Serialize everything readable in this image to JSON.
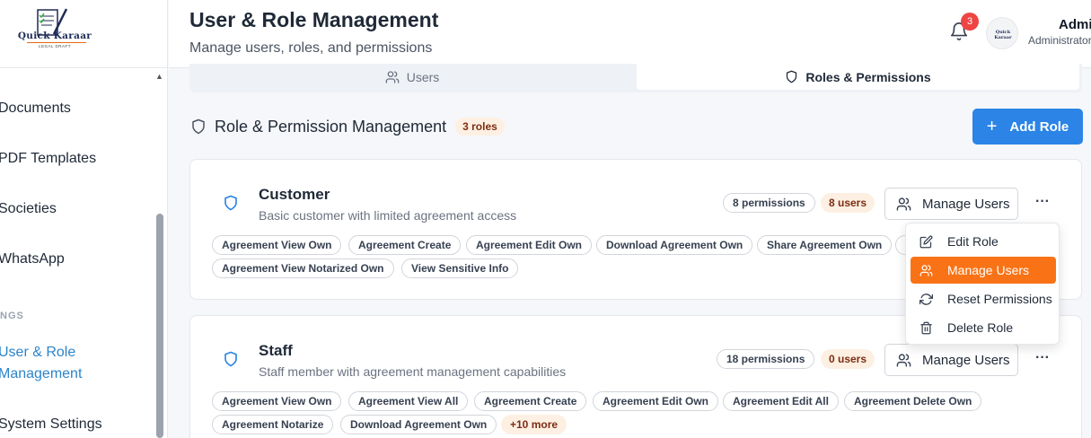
{
  "brand": {
    "name": "Quick Karaar",
    "tagline": "LEGAL DRAFT",
    "avatar_text": "Quick Karaar"
  },
  "sidebar": {
    "items": [
      {
        "label": "Documents"
      },
      {
        "label": "PDF Templates"
      },
      {
        "label": "Societies"
      },
      {
        "label": "WhatsApp"
      }
    ],
    "section_label": "NGS",
    "active_item": {
      "line1": "User & Role",
      "line2": "Management"
    },
    "after_items": [
      {
        "label": "System Settings"
      }
    ]
  },
  "header": {
    "title": "User & Role Management",
    "subtitle": "Manage users, roles, and permissions",
    "notification_count": "3",
    "user_name": "Admin",
    "user_role": "Administrator"
  },
  "tabs": [
    {
      "label": "Users",
      "icon": "users-icon",
      "active": false
    },
    {
      "label": "Roles & Permissions",
      "icon": "shield-icon",
      "active": true
    }
  ],
  "section": {
    "title": "Role & Permission Management",
    "count_badge": "3 roles",
    "add_button": "Add Role"
  },
  "roles": [
    {
      "name": "Customer",
      "description": "Basic customer with limited agreement access",
      "permissions_count": "8 permissions",
      "users_count": "8 users",
      "manage_label": "Manage Users",
      "permissions": [
        "Agreement View Own",
        "Agreement Create",
        "Agreement Edit Own",
        "Download Agreement Own",
        "Share Agreement Own",
        "",
        "Agreement View Notarized Own",
        "View Sensitive Info"
      ]
    },
    {
      "name": "Staff",
      "description": "Staff member with agreement management capabilities",
      "permissions_count": "18 permissions",
      "users_count": "0 users",
      "manage_label": "Manage Users",
      "permissions": [
        "Agreement View Own",
        "Agreement View All",
        "Agreement Create",
        "Agreement Edit Own",
        "Agreement Edit All",
        "Agreement Delete Own",
        "Agreement Notarize",
        "Download Agreement Own"
      ],
      "more_label": "+10 more"
    }
  ],
  "dropdown": {
    "items": [
      {
        "label": "Edit Role",
        "icon": "edit-icon"
      },
      {
        "label": "Manage Users",
        "icon": "users-icon",
        "highlighted": true
      },
      {
        "label": "Reset Permissions",
        "icon": "refresh-icon"
      },
      {
        "label": "Delete Role",
        "icon": "trash-icon"
      }
    ]
  },
  "colors": {
    "primary": "#2b84e6",
    "accent": "#f97316",
    "badge_bg": "#fdf0e3",
    "badge_text": "#7c2d12",
    "notification": "#ef4444",
    "active_nav": "#2b84c9"
  }
}
